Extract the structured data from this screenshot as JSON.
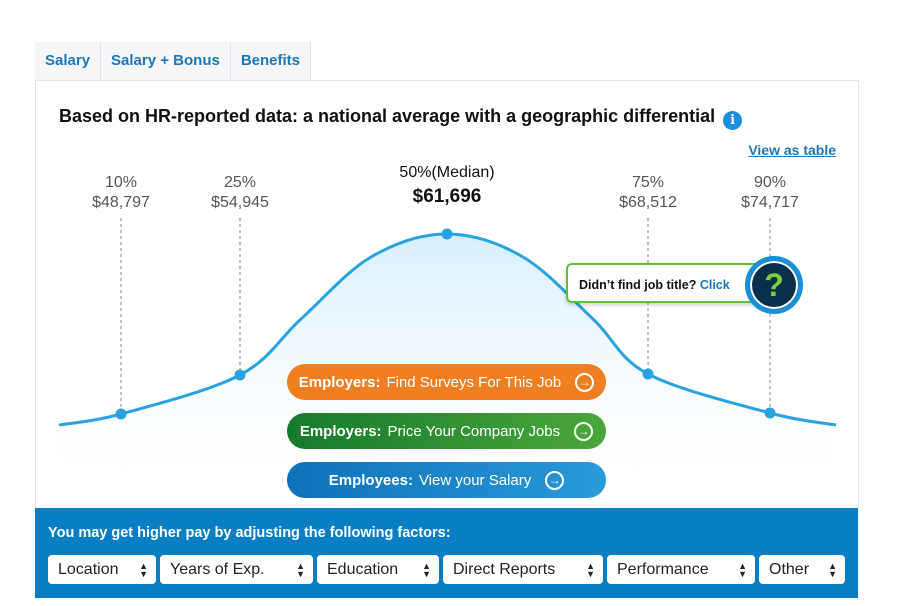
{
  "tabs": [
    "Salary",
    "Salary + Bonus",
    "Benefits"
  ],
  "title": "Based on HR-reported data: a national average with a geographic differential",
  "info_icon": "i",
  "view_as_table": "View as table",
  "chart_data": {
    "type": "line",
    "percentiles": [
      {
        "label": "10%",
        "value": "$48,797"
      },
      {
        "label": "25%",
        "value": "$54,945"
      },
      {
        "label": "50%(Median)",
        "value": "$61,696"
      },
      {
        "label": "75%",
        "value": "$68,512"
      },
      {
        "label": "90%",
        "value": "$74,717"
      }
    ],
    "line_color": "#29a3e0"
  },
  "buttons": [
    {
      "bold": "Employers:",
      "text": "Find Surveys For This Job",
      "color": "#f07f22"
    },
    {
      "bold": "Employers:",
      "text": "Price Your Company Jobs",
      "color": "#1e8a32"
    },
    {
      "bold": "Employees:",
      "text": "View your Salary",
      "color": "#1a82c8"
    }
  ],
  "help": {
    "text": "Didn’t find job title?",
    "link": "Click",
    "icon": "?"
  },
  "factors": {
    "title": "You may get higher pay by adjusting the following factors:",
    "selects": [
      "Location",
      "Years of Exp.",
      "Education",
      "Direct Reports",
      "Performance",
      "Other"
    ]
  }
}
